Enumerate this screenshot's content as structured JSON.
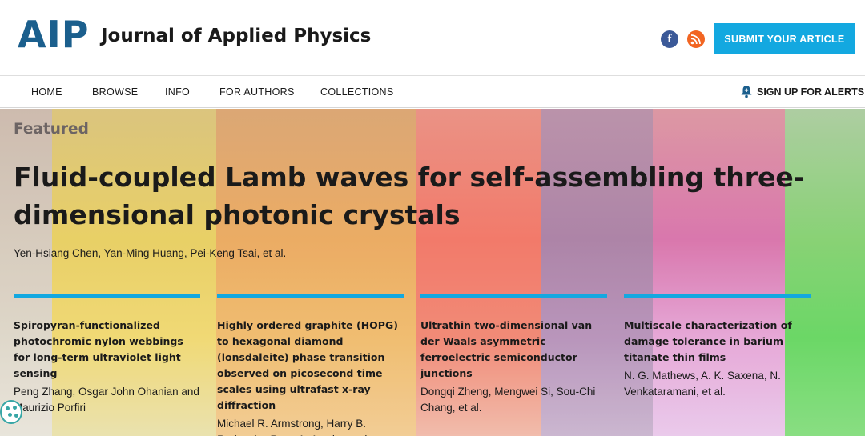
{
  "header": {
    "logo_text": "AIP",
    "journal_title": "Journal of Applied Physics",
    "submit_label": "SUBMIT YOUR ARTICLE",
    "facebook_glyph": "f",
    "icons": [
      "facebook-icon",
      "rss-icon"
    ]
  },
  "nav": {
    "items": [
      "HOME",
      "BROWSE",
      "INFO",
      "FOR AUTHORS",
      "COLLECTIONS"
    ],
    "alerts_label": "SIGN UP FOR ALERTS"
  },
  "featured": {
    "label": "Featured",
    "title": "Fluid-coupled Lamb waves for self-assembling three-dimensional photonic crystals",
    "authors": "Yen-Hsiang Chen, Yan-Ming Huang, Pei-Keng Tsai, et al."
  },
  "articles": [
    {
      "title": "Spiropyran-functionalized photochromic nylon webbings for long-term ultraviolet light sensing",
      "authors": "Peng Zhang, Osgar John Ohanian and Maurizio Porfiri"
    },
    {
      "title": "Highly ordered graphite (HOPG) to hexagonal diamond (lonsdaleite) phase transition observed on picosecond time scales using ultrafast x-ray diffraction",
      "authors": "Michael R. Armstrong, Harry B. Radousky, Ryan A. Austin, et al."
    },
    {
      "title": "Ultrathin two-dimensional van der Waals asymmetric ferroelectric semiconductor junctions",
      "authors": "Dongqi Zheng, Mengwei Si, Sou-Chi Chang, et al."
    },
    {
      "title": "Multiscale characterization of damage tolerance in barium titanate thin films",
      "authors": "N. G. Mathews, A. K. Saxena, N. Venkataramani, et al."
    }
  ],
  "colors": {
    "brand_blue": "#1b5f8d",
    "accent_cyan": "#13a8e0",
    "facebook": "#3b5998",
    "rss": "#f26522"
  }
}
